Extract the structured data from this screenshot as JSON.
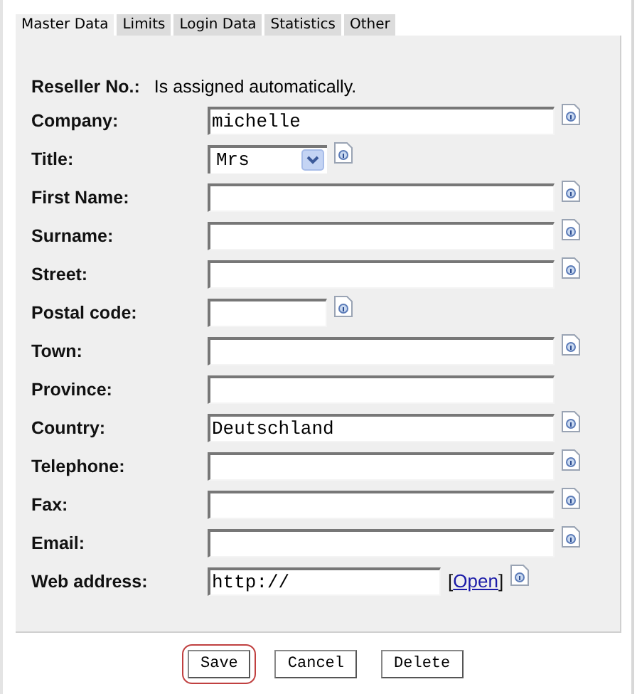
{
  "tabs": [
    {
      "label": "Master Data",
      "selected": true
    },
    {
      "label": "Limits",
      "selected": false
    },
    {
      "label": "Login Data",
      "selected": false
    },
    {
      "label": "Statistics",
      "selected": false
    },
    {
      "label": "Other",
      "selected": false
    }
  ],
  "reseller": {
    "label": "Reseller No.:",
    "value": "Is assigned automatically."
  },
  "fields": [
    {
      "label": "Company:",
      "kind": "text",
      "value": "michelle",
      "info": true
    },
    {
      "label": "Title:",
      "kind": "select",
      "value": "Mrs",
      "info": true
    },
    {
      "label": "First Name:",
      "kind": "text",
      "info": true
    },
    {
      "label": "Surname:",
      "kind": "text",
      "info": true
    },
    {
      "label": "Street:",
      "kind": "text",
      "info": true
    },
    {
      "label": "Postal code:",
      "kind": "short",
      "info": true
    },
    {
      "label": "Town:",
      "kind": "text",
      "info": true
    },
    {
      "label": "Province:",
      "kind": "text",
      "info": false
    },
    {
      "label": "Country:",
      "kind": "text",
      "value": "Deutschland",
      "info": true
    },
    {
      "label": "Telephone:",
      "kind": "text",
      "info": true
    },
    {
      "label": "Fax:",
      "kind": "text",
      "info": true
    },
    {
      "label": "Email:",
      "kind": "text",
      "info": true
    },
    {
      "label": "Web address:",
      "kind": "url",
      "value": "http://",
      "link_open": "[",
      "link": "Open",
      "link_close": "]",
      "info": true
    }
  ],
  "buttons": [
    {
      "label": "Save",
      "highlighted": true
    },
    {
      "label": "Cancel",
      "highlighted": false
    },
    {
      "label": "Delete",
      "highlighted": false
    }
  ]
}
